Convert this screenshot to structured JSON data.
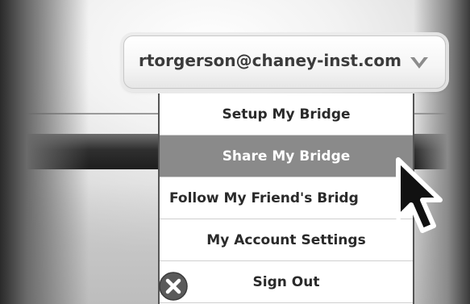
{
  "account": {
    "email": "rtorgerson@chaney-inst.com",
    "chevron_icon": "chevron-down-icon"
  },
  "menu": {
    "items": [
      {
        "label": "Setup My Bridge",
        "active": false
      },
      {
        "label": "Share My Bridge",
        "active": true
      },
      {
        "label": "Follow My Friend's Bridg",
        "active": false
      },
      {
        "label": "My Account Settings",
        "active": false
      },
      {
        "label": "Sign Out",
        "active": false,
        "icon": "close-circle-icon"
      }
    ]
  },
  "colors": {
    "active_item_bg": "#8a8a8a",
    "active_item_text": "#ffffff",
    "item_text": "#2a2a2a"
  },
  "cursor": {
    "icon": "arrow-cursor-icon"
  }
}
